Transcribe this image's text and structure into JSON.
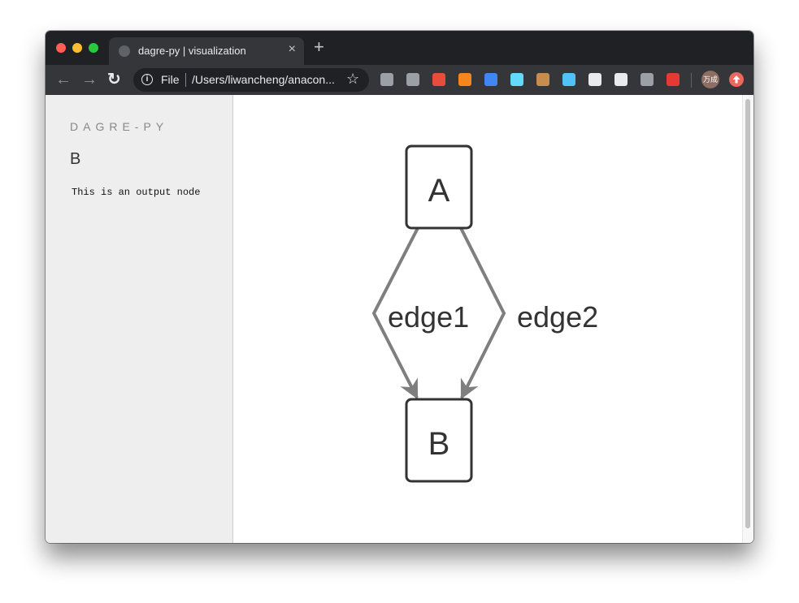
{
  "window": {
    "tab": {
      "title": "dagre-py | visualization",
      "close_glyph": "×",
      "favicon": "globe-icon"
    },
    "new_tab_glyph": "+"
  },
  "toolbar": {
    "back_glyph": "←",
    "forward_glyph": "→",
    "reload_glyph": "↻",
    "scheme_label": "File",
    "url": "/Users/liwancheng/anacon...",
    "bookmark_glyph": "☆",
    "extensions": [
      {
        "name": "json-viewer-extension-icon",
        "color": "#9aa0a6"
      },
      {
        "name": "vue-devtools-extension-icon",
        "color": "#9aa0a6"
      },
      {
        "name": "color-palette-extension-icon",
        "color": "#e74c3c"
      },
      {
        "name": "metamask-extension-icon",
        "color": "#f6851b"
      },
      {
        "name": "translate-extension-icon",
        "color": "#4285f4"
      },
      {
        "name": "react-devtools-extension-icon",
        "color": "#61dafb"
      },
      {
        "name": "cookie-extension-icon",
        "color": "#c68e4e"
      },
      {
        "name": "window-resizer-extension-icon",
        "color": "#4fc3f7"
      },
      {
        "name": "cat-extension-icon",
        "color": "#e8eaed"
      },
      {
        "name": "tampermonkey-extension-icon",
        "color": "#e8eaed"
      },
      {
        "name": "text-cursor-extension-icon",
        "color": "#9aa0a6"
      },
      {
        "name": "adblock-extension-icon",
        "color": "#e53935"
      }
    ],
    "profile_label": "万成",
    "update_icon": "arrow-up-icon"
  },
  "sidebar": {
    "brand": "DAGRE-PY",
    "selected_node": "B",
    "description": "This is an output node"
  },
  "graph": {
    "nodes": [
      {
        "id": "A",
        "label": "A"
      },
      {
        "id": "B",
        "label": "B"
      }
    ],
    "edges": [
      {
        "from": "A",
        "to": "B",
        "label": "edge1"
      },
      {
        "from": "A",
        "to": "B",
        "label": "edge2"
      }
    ],
    "edge_color": "#7f7f7f",
    "node_border_color": "#333333"
  }
}
